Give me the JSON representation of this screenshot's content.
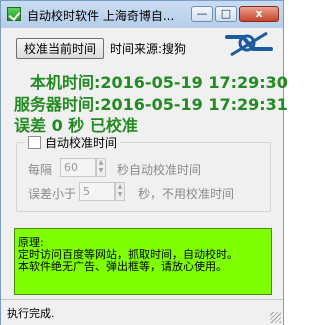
{
  "window": {
    "title": "自动校时软件 上海奇博自..."
  },
  "titlebar": {
    "minimize": "—",
    "maximize": "□",
    "close": "x"
  },
  "toolbar": {
    "calibrate_label": "校准当前时间",
    "source_label": "时间来源:搜狗"
  },
  "main": {
    "local_time": "本机时间:2016-05-19 17:29:30",
    "server_time": "服务器时间:2016-05-19 17:29:31",
    "error_status": "误差 0 秒  已校准"
  },
  "auto": {
    "legend": "自动校准时间",
    "every_label": "每隔",
    "every_value": "60",
    "every_suffix": "秒自动校准时间",
    "error_label": "误差小于",
    "error_value": "5",
    "error_suffix": "秒，不用校准时间"
  },
  "note": {
    "heading": "原理:",
    "line1": "定时访问百度等网站，抓取时间，自动校时。",
    "line2": "本软件绝无广告、弹出框等，请放心使用。"
  },
  "status": {
    "text": "执行完成."
  },
  "colors": {
    "accent_green": "#228b22",
    "note_bg": "#80ff00",
    "logo_blue": "#1e5aa0"
  }
}
